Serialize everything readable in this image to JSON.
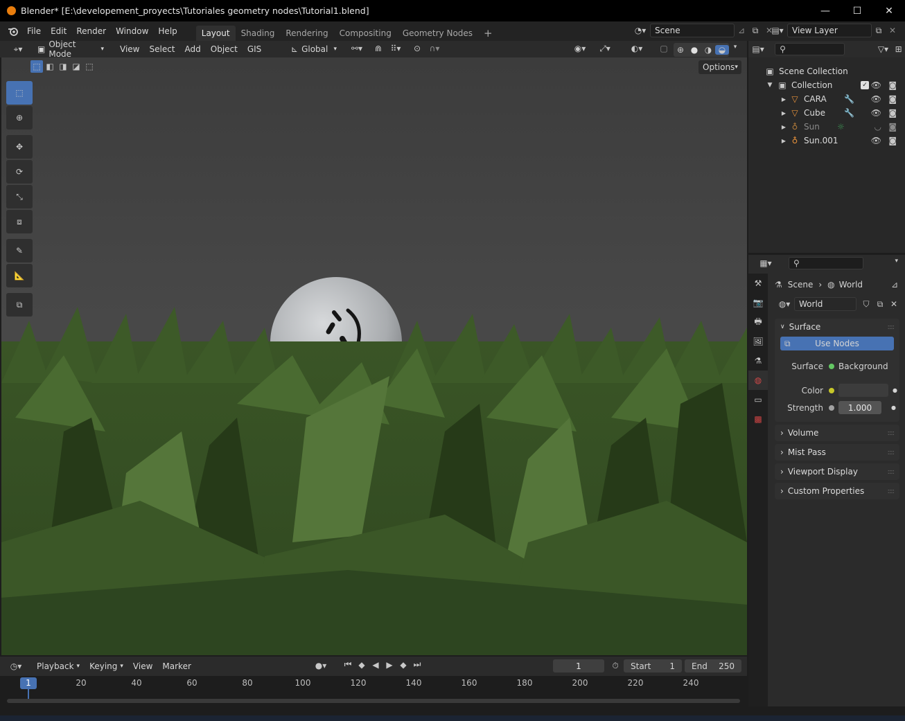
{
  "window": {
    "title": "Blender* [E:\\developement_proyects\\Tutoriales geometry nodes\\Tutorial1.blend]",
    "minimize": "—",
    "maximize": "☐",
    "close": "✕"
  },
  "menu": {
    "items": [
      "File",
      "Edit",
      "Render",
      "Window",
      "Help"
    ]
  },
  "workspaces": {
    "tabs": [
      "Layout",
      "Shading",
      "Rendering",
      "Compositing",
      "Geometry Nodes"
    ],
    "active": "Layout",
    "add": "+"
  },
  "scene": {
    "name": "Scene"
  },
  "view_layer": {
    "name": "View Layer"
  },
  "viewport_header": {
    "mode": "Object Mode",
    "menus": [
      "View",
      "Select",
      "Add",
      "Object",
      "GIS"
    ],
    "orientation": "Global",
    "options": "Options"
  },
  "outliner": {
    "root": "Scene Collection",
    "collection": "Collection",
    "objects": [
      {
        "name": "CARA",
        "type": "mesh",
        "dim": false
      },
      {
        "name": "Cube",
        "type": "mesh",
        "dim": false
      },
      {
        "name": "Sun",
        "type": "light",
        "dim": true
      },
      {
        "name": "Sun.001",
        "type": "light",
        "dim": false
      }
    ]
  },
  "properties": {
    "breadcrumb_scene": "Scene",
    "breadcrumb_world": "World",
    "world_name": "World",
    "panels": {
      "surface": "Surface",
      "use_nodes": "Use Nodes",
      "surface_label": "Surface",
      "surface_value": "Background",
      "color_label": "Color",
      "strength_label": "Strength",
      "strength_value": "1.000",
      "volume": "Volume",
      "mist_pass": "Mist Pass",
      "viewport_display": "Viewport Display",
      "custom_properties": "Custom Properties"
    }
  },
  "timeline": {
    "menus": [
      "Playback",
      "Keying",
      "View",
      "Marker"
    ],
    "current_frame": "1",
    "start_label": "Start",
    "start": "1",
    "end_label": "End",
    "end": "250",
    "ticks": [
      "1",
      "20",
      "40",
      "60",
      "80",
      "100",
      "120",
      "140",
      "160",
      "180",
      "200",
      "220",
      "240"
    ]
  },
  "colors": {
    "accent": "#4772b3",
    "grass_dark": "#2a3d1c",
    "grass_mid": "#3f5a2a",
    "grass_light": "#5b7a3e"
  }
}
